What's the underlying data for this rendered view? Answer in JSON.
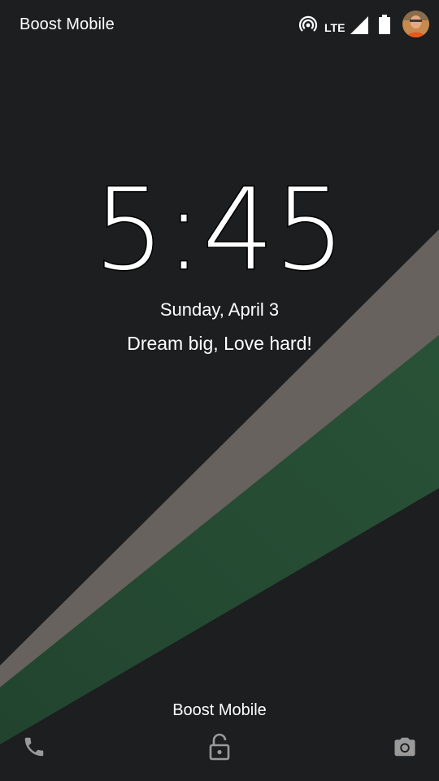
{
  "status_bar": {
    "carrier": "Boost Mobile",
    "network_type": "LTE",
    "icons": [
      "hotspot-icon",
      "signal-icon",
      "battery-icon",
      "avatar"
    ]
  },
  "lockscreen": {
    "time": "5:45",
    "date": "Sunday, April 3",
    "owner_info": "Dream big, Love hard!",
    "carrier": "Boost Mobile"
  },
  "bottom_actions": {
    "left": "phone-icon",
    "center": "unlock-icon",
    "right": "camera-icon"
  },
  "colors": {
    "background": "#1c1e1f",
    "gray_stripe": "#67625e",
    "green_stripe": "#244a33",
    "icon_gray": "#9a9a9a"
  }
}
